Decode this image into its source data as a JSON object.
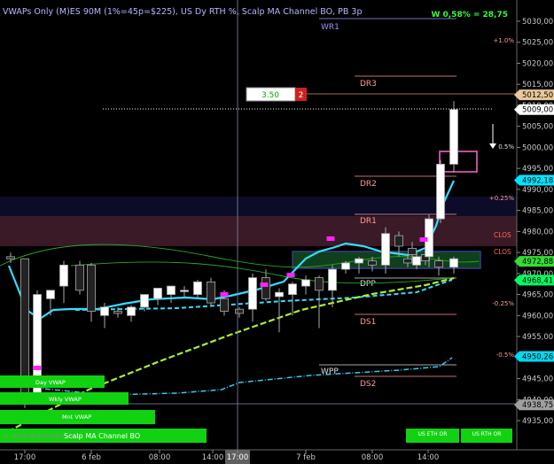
{
  "header": {
    "title": "VWAPs Only (M)ES 90M  (1%=45p=$225), US Dy RTH %, Scalp MA Channel BO, PB 3p",
    "pnl": "W 0,58% = 28,75"
  },
  "order_box": {
    "value": "3.50",
    "count": "2"
  },
  "price_axis": {
    "ticks": [
      "5030,00",
      "5025,00",
      "5020,00",
      "5015,00",
      "5010,00",
      "5005,00",
      "5000,00",
      "4995,00",
      "4990,00",
      "4985,00",
      "4980,00",
      "4975,00",
      "4970,00",
      "4965,00",
      "4960,00",
      "4955,00",
      "4950,00",
      "4945,00",
      "4940,00",
      "4935,00"
    ],
    "tick_values": [
      5030,
      5025,
      5020,
      5015,
      5010,
      5005,
      5000,
      4995,
      4990,
      4985,
      4980,
      4975,
      4970,
      4965,
      4960,
      4955,
      4950,
      4945,
      4940,
      4935
    ],
    "markers": [
      {
        "text": "5012,50",
        "value": 5012.5,
        "bg": "#e8c89a",
        "fg": "#000000"
      },
      {
        "text": "5009,00",
        "value": 5009.0,
        "bg": "#ffffff",
        "fg": "#000000"
      },
      {
        "text": "4992,18",
        "value": 4992.18,
        "bg": "#00e5ff",
        "fg": "#000000"
      },
      {
        "text": "4972,88",
        "value": 4972.88,
        "bg": "#33dd33",
        "fg": "#000000"
      },
      {
        "text": "4968,41",
        "value": 4968.41,
        "bg": "#00ff66",
        "fg": "#000000"
      },
      {
        "text": "4950,26",
        "value": 4950.26,
        "bg": "#00d8f0",
        "fg": "#000000"
      },
      {
        "text": "4938,75",
        "value": 4938.75,
        "bg": "#a0a0a0",
        "fg": "#000000"
      }
    ]
  },
  "time_axis": {
    "labels": [
      "17:00",
      "6 feb",
      "08:00",
      "14:00",
      "17:00",
      "7 feb",
      "08:00",
      "14:00"
    ],
    "highlight": "17:00"
  },
  "levels": {
    "WR1": "WR1",
    "DR3": "DR3",
    "DR2": "DR2",
    "DR1": "DR1",
    "CLOS1": "CLOS",
    "CLOS2": "CLOS",
    "DPP": "DPP",
    "DS1": "DS1",
    "WPP": "WPP",
    "DS2": "DS2"
  },
  "pct_labels": [
    "+1.0%",
    "0.5%",
    "+0.25%",
    "-0.25%",
    "-0.5%"
  ],
  "vwap_labels": [
    "Day VWAP",
    "Wkly VWAP",
    "Mnt VWAP"
  ],
  "footer": {
    "watermark": "© 2024 NinjaTrader, LLC",
    "indicator": "Scalp MA Channel BO",
    "btn1": "US ETH OR",
    "btn2": "US RTH OR"
  },
  "chart_data": {
    "type": "candlestick",
    "title": "VWAPs Only (M)ES 90M  (1%=45p=$225), US Dy RTH %, Scalp MA Channel BO, PB 3p",
    "y_range": [
      4933,
      5033
    ],
    "time_labels": [
      "17:00",
      "6 feb",
      "08:00",
      "14:00",
      "17:00",
      "7 feb",
      "08:00",
      "14:00"
    ],
    "candles": [
      {
        "o": 4974.0,
        "h": 4975.0,
        "l": 4972.5,
        "c": 4973.5
      },
      {
        "o": 4973.5,
        "h": 4973.5,
        "l": 4938.0,
        "c": 4940.0
      },
      {
        "o": 4941.0,
        "h": 4966.0,
        "l": 4940.0,
        "c": 4965.0
      },
      {
        "o": 4964.0,
        "h": 4966.0,
        "l": 4960.0,
        "c": 4966.0
      },
      {
        "o": 4967.0,
        "h": 4973.0,
        "l": 4963.0,
        "c": 4972.0
      },
      {
        "o": 4972.0,
        "h": 4973.0,
        "l": 4965.0,
        "c": 4966.0
      },
      {
        "o": 4972.0,
        "h": 4972.5,
        "l": 4958.5,
        "c": 4961.0
      },
      {
        "o": 4960.0,
        "h": 4963.0,
        "l": 4957.0,
        "c": 4962.0
      },
      {
        "o": 4961.0,
        "h": 4962.0,
        "l": 4959.5,
        "c": 4960.5
      },
      {
        "o": 4960.0,
        "h": 4962.5,
        "l": 4958.5,
        "c": 4962.0
      },
      {
        "o": 4962.0,
        "h": 4965.0,
        "l": 4961.0,
        "c": 4965.0
      },
      {
        "o": 4964.0,
        "h": 4966.5,
        "l": 4962.5,
        "c": 4966.5
      },
      {
        "o": 4965.0,
        "h": 4967.0,
        "l": 4963.0,
        "c": 4967.0
      },
      {
        "o": 4966.0,
        "h": 4967.0,
        "l": 4964.5,
        "c": 4966.0
      },
      {
        "o": 4965.0,
        "h": 4968.5,
        "l": 4964.0,
        "c": 4968.0
      },
      {
        "o": 4968.0,
        "h": 4969.0,
        "l": 4962.5,
        "c": 4963.0
      },
      {
        "o": 4964.0,
        "h": 4966.0,
        "l": 4960.0,
        "c": 4961.0
      },
      {
        "o": 4961.5,
        "h": 4962.0,
        "l": 4959.5,
        "c": 4960.5
      },
      {
        "o": 4961.5,
        "h": 4970.0,
        "l": 4958.5,
        "c": 4969.0
      },
      {
        "o": 4969.0,
        "h": 4971.0,
        "l": 4963.5,
        "c": 4964.0
      },
      {
        "o": 4964.5,
        "h": 4966.5,
        "l": 4956.0,
        "c": 4965.5
      },
      {
        "o": 4965.0,
        "h": 4968.0,
        "l": 4960.0,
        "c": 4967.5
      },
      {
        "o": 4967.0,
        "h": 4969.5,
        "l": 4965.0,
        "c": 4968.5
      },
      {
        "o": 4969.0,
        "h": 4969.5,
        "l": 4957.0,
        "c": 4966.0
      },
      {
        "o": 4966.0,
        "h": 4972.0,
        "l": 4962.0,
        "c": 4971.0
      },
      {
        "o": 4971.0,
        "h": 4973.0,
        "l": 4970.0,
        "c": 4972.5
      },
      {
        "o": 4972.5,
        "h": 4974.0,
        "l": 4970.0,
        "c": 4973.5
      },
      {
        "o": 4973.0,
        "h": 4974.0,
        "l": 4970.5,
        "c": 4972.0
      },
      {
        "o": 4972.0,
        "h": 4981.0,
        "l": 4970.0,
        "c": 4979.5
      },
      {
        "o": 4979.0,
        "h": 4980.0,
        "l": 4974.0,
        "c": 4976.5
      },
      {
        "o": 4976.0,
        "h": 4977.5,
        "l": 4973.0,
        "c": 4974.5
      },
      {
        "o": 4974.5,
        "h": 4975.5,
        "l": 4972.0,
        "c": 4973.0
      },
      {
        "o": 4973.0,
        "h": 4974.0,
        "l": 4969.5,
        "c": 4971.5
      },
      {
        "o": 4971.5,
        "h": 4974.0,
        "l": 4970.0,
        "c": 4973.5
      },
      {
        "o": 4973.5,
        "h": 4974.5,
        "l": 4971.5,
        "c": 4972.5
      },
      {
        "o": 4972.0,
        "h": 4975.0,
        "l": 4971.0,
        "c": 4974.0
      },
      {
        "o": 4974.0,
        "h": 4984.0,
        "l": 4971.5,
        "c": 4983.0
      },
      {
        "o": 4983.0,
        "h": 4997.0,
        "l": 4982.0,
        "c": 4996.0
      },
      {
        "o": 4996.0,
        "h": 5011.0,
        "l": 4994.0,
        "c": 5009.0
      }
    ],
    "series": [
      {
        "name": "Day VWAP",
        "color": "#33ccff"
      },
      {
        "name": "Wkly VWAP",
        "color": "#33ccff"
      },
      {
        "name": "Mnt VWAP",
        "color": "#33ccee"
      }
    ]
  }
}
